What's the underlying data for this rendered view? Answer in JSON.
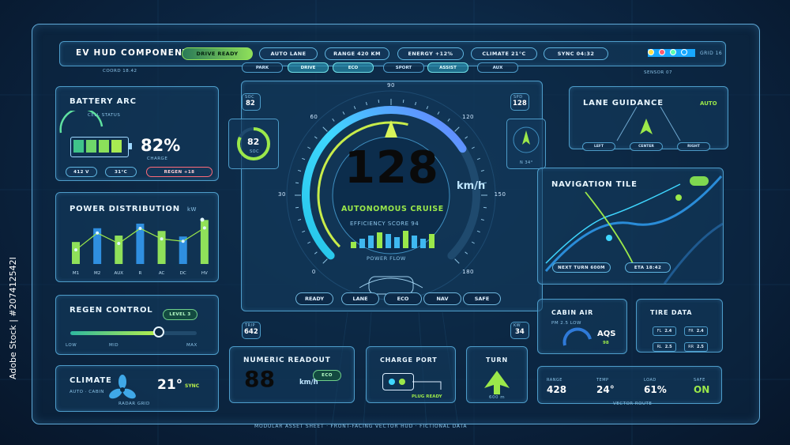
{
  "header": {
    "title": "EV HUD COMPONENT SYSTEM",
    "status_pills": [
      "DRIVE READY",
      "AUTO LANE",
      "RANGE 420 KM",
      "ENERGY +12%",
      "CLIMATE 21°C",
      "SYNC 04:32"
    ],
    "grid_label": "GRID 16",
    "coord_label": "COORD 18.42",
    "sensor_label": "SENSOR 07",
    "nav_modes": [
      "PARK",
      "DRIVE",
      "ECO",
      "SPORT",
      "ASSIST",
      "AUX"
    ],
    "active_nav_modes": [
      "DRIVE",
      "ECO",
      "ASSIST"
    ],
    "indicator_colors": [
      "#18a8ff",
      "#ffe04a",
      "#ff5a6e",
      "#5affb0"
    ]
  },
  "battery": {
    "title": "BATTERY ARC",
    "subtitle": "CELL STATUS",
    "percent": "82%",
    "charge_label": "CHARGE",
    "voltage": "412 V",
    "temp": "31°C",
    "regen": "REGEN +18",
    "level_fraction": 0.82
  },
  "power": {
    "title": "POWER DISTRIBUTION",
    "unit": "kW",
    "categories": [
      "M1",
      "M2",
      "AUX",
      "R",
      "AC",
      "DC",
      "HV"
    ]
  },
  "regen": {
    "title": "REGEN CONTROL",
    "level_badge": "LEVEL 3",
    "low": "LOW",
    "mid": "MID",
    "max": "MAX",
    "value_fraction": 0.7
  },
  "climate": {
    "title": "CLIMATE",
    "subtitle": "AUTO · CABIN",
    "temp": "21°",
    "sync": "SYNC",
    "footer": "RADAR GRID"
  },
  "gauge": {
    "speed": "128",
    "unit": "km/h",
    "mode": "AUTONOMOUS CRUISE",
    "efficiency": "EFFICIENCY SCORE 94",
    "power_flow": "POWER FLOW",
    "ticks": [
      "0",
      "30",
      "60",
      "90",
      "120",
      "150",
      "180"
    ],
    "buttons": [
      "READY",
      "LANE",
      "ECO",
      "NAV",
      "SAFE"
    ],
    "soc_label": "SOC",
    "soc_value": "82",
    "spd_label": "SPD",
    "spd_value": "128",
    "trip_label": "TRIP",
    "trip_value": "642",
    "kw_label": "KW",
    "kw_value": "34",
    "ring_value": "82",
    "ring_label": "SOC",
    "heading": "N 34°",
    "speed_fraction": 0.711
  },
  "lane": {
    "title": "LANE GUIDANCE",
    "mode": "AUTO",
    "buttons": [
      "LEFT",
      "CENTER",
      "RIGHT"
    ]
  },
  "nav": {
    "title": "NAVIGATION TILE",
    "next_turn": "NEXT TURN 600M",
    "eta": "ETA 18:42"
  },
  "cabin": {
    "title": "CABIN AIR",
    "pm": "PM 2.5 LOW",
    "aqs": "AQS",
    "aqs_value": "98"
  },
  "tire": {
    "title": "TIRE DATA",
    "cells": [
      {
        "pos": "FL",
        "val": "2.4"
      },
      {
        "pos": "FR",
        "val": "2.4"
      },
      {
        "pos": "RL",
        "val": "2.5"
      },
      {
        "pos": "RR",
        "val": "2.5"
      }
    ]
  },
  "numeric": {
    "title": "NUMERIC READOUT",
    "value": "88",
    "unit": "km/h",
    "badge": "ECO"
  },
  "charge": {
    "title": "CHARGE PORT",
    "status": "PLUG READY"
  },
  "turn": {
    "title": "TURN",
    "distance": "600 m"
  },
  "vector": {
    "items": [
      {
        "label": "RANGE",
        "value": "428"
      },
      {
        "label": "TEMP",
        "value": "24°"
      },
      {
        "label": "LOAD",
        "value": "61%"
      },
      {
        "label": "SAFE",
        "value": "ON"
      }
    ],
    "footer": "VECTOR ROUTE"
  },
  "footer": {
    "text": "MODULAR ASSET SHEET · FRONT-FACING VECTOR HUD · FICTIONAL DATA",
    "side_id": "Adobe Stock | #207412542I"
  },
  "chart_data": {
    "type": "bar",
    "categories": [
      "M1",
      "M2",
      "AUX",
      "R",
      "AC",
      "DC",
      "HV"
    ],
    "values": [
      48,
      78,
      62,
      88,
      72,
      60,
      96
    ],
    "ylim": [
      0,
      100
    ]
  },
  "colors": {
    "accent": "#3fd7ff",
    "green": "#9be84a",
    "text": "#e8f6ff",
    "panel_border": "#4d9cc9"
  }
}
